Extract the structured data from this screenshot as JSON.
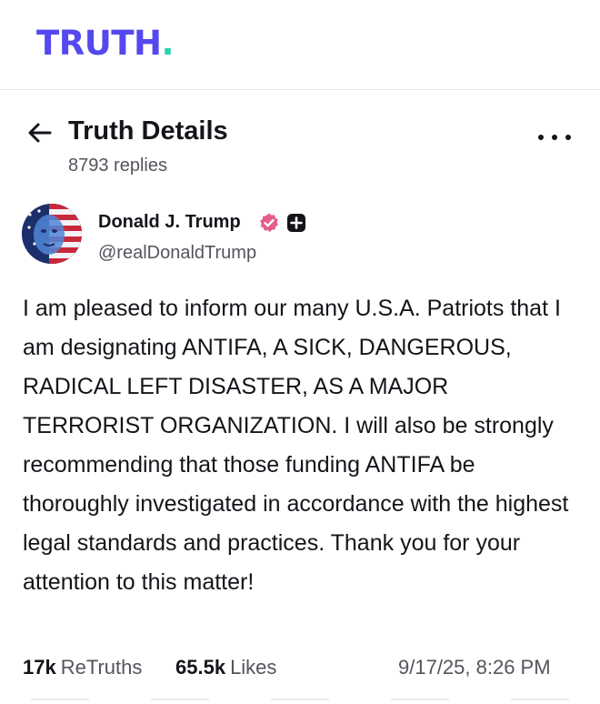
{
  "app": {
    "logo_text": "TRUTH",
    "logo_dot": ".",
    "brand_color": "#5448ee",
    "accent_color": "#2ad1b1"
  },
  "header": {
    "back_icon": "arrow-left-icon",
    "title": "Truth Details",
    "replies": "8793 replies",
    "more_icon": "more-horizontal-icon"
  },
  "author": {
    "name": "Donald J. Trump",
    "handle": "@realDonaldTrump",
    "verified_icon": "verified-badge-icon",
    "verified_color": "#e55d8c",
    "plus_icon": "plus-badge-icon",
    "avatar_icon": "avatar-image"
  },
  "post": {
    "text": "I am pleased to inform our many U.S.A. Patriots that I am designating ANTIFA, A SICK, DANGEROUS, RADICAL LEFT DISASTER, AS A MAJOR TERRORIST ORGANIZATION. I will also be strongly recommending that those funding ANTIFA be thoroughly investigated in accordance with the highest legal standards and practices. Thank you for your attention to this matter!"
  },
  "stats": {
    "retruths_count": "17k",
    "retruths_label": "ReTruths",
    "likes_count": "65.5k",
    "likes_label": "Likes",
    "timestamp": "9/17/25, 8:26 PM"
  }
}
